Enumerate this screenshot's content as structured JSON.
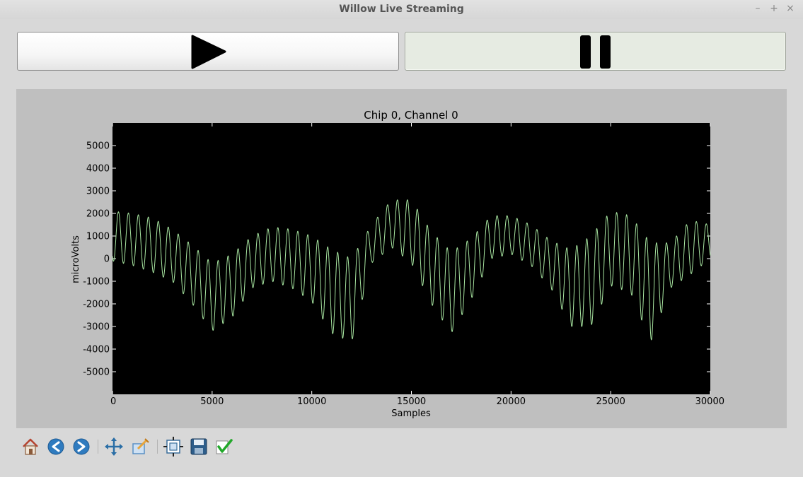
{
  "window": {
    "title": "Willow Live Streaming",
    "controls": [
      "–",
      "+",
      "×"
    ]
  },
  "buttons": {
    "play_icon": "play-icon",
    "pause_icon": "pause-icon"
  },
  "chart_data": {
    "type": "line",
    "title": "Chip 0, Channel 0",
    "xlabel": "Samples",
    "ylabel": "microVolts",
    "xlim": [
      0,
      30000
    ],
    "ylim": [
      -6000,
      6000
    ],
    "xticks": [
      0,
      5000,
      10000,
      15000,
      20000,
      25000,
      30000
    ],
    "xtick_labels": [
      "0",
      "5000",
      "10000",
      "15000",
      "20000",
      "25000",
      "30000"
    ],
    "yticks": [
      5000,
      4000,
      3000,
      2000,
      1000,
      0,
      -1000,
      -2000,
      -3000,
      -4000,
      -5000
    ],
    "ytick_labels": [
      "5000",
      "4000",
      "3000",
      "2000",
      "1000",
      "0",
      "-1000",
      "-2000",
      "-3000",
      "-4000",
      "-5000"
    ],
    "background": "#000000",
    "line_color": "#a8e6a1",
    "grid": false,
    "series": [
      {
        "x": [
          0,
          1000,
          2000,
          3000,
          4000,
          5000,
          6000,
          7000,
          8000,
          9000,
          10000,
          11000,
          12000,
          13000,
          14000,
          15000,
          16000,
          17000,
          18000,
          19000,
          20000,
          21000,
          22000,
          23000,
          24000,
          25000,
          26000,
          27000,
          28000,
          29000,
          30000
        ],
        "upper": [
          2100,
          2000,
          1800,
          1300,
          600,
          -200,
          200,
          1000,
          1400,
          1300,
          1000,
          400,
          0,
          1500,
          2600,
          2600,
          1200,
          300,
          900,
          1900,
          1900,
          1500,
          800,
          400,
          1000,
          2100,
          1900,
          700,
          700,
          1700,
          1500
        ],
        "lower": [
          -100,
          -300,
          -600,
          -1000,
          -2000,
          -3200,
          -2600,
          -1300,
          -1000,
          -1300,
          -1900,
          -3300,
          -3700,
          -200,
          500,
          -200,
          -2000,
          -3300,
          -1800,
          0,
          200,
          -300,
          -1300,
          -3000,
          -3000,
          -1200,
          -1500,
          -3700,
          -1300,
          -700,
          0
        ],
        "cycle_samples": 500
      }
    ]
  },
  "toolbar": {
    "items": [
      {
        "icon": "home-icon",
        "color": "#b5432f"
      },
      {
        "icon": "back-arrow-icon",
        "color": "#2f7bbf"
      },
      {
        "icon": "forward-arrow-icon",
        "color": "#2f7bbf"
      },
      {
        "icon": "pan-icon",
        "color": "#2a6ea6"
      },
      {
        "icon": "zoom-rect-icon",
        "color": "#5a8fc4"
      },
      {
        "icon": "subplots-icon",
        "color": "#3a6d9a"
      },
      {
        "icon": "save-icon",
        "color": "#2d5d8a"
      },
      {
        "icon": "edit-params-icon",
        "color": "#22a82a"
      }
    ]
  }
}
